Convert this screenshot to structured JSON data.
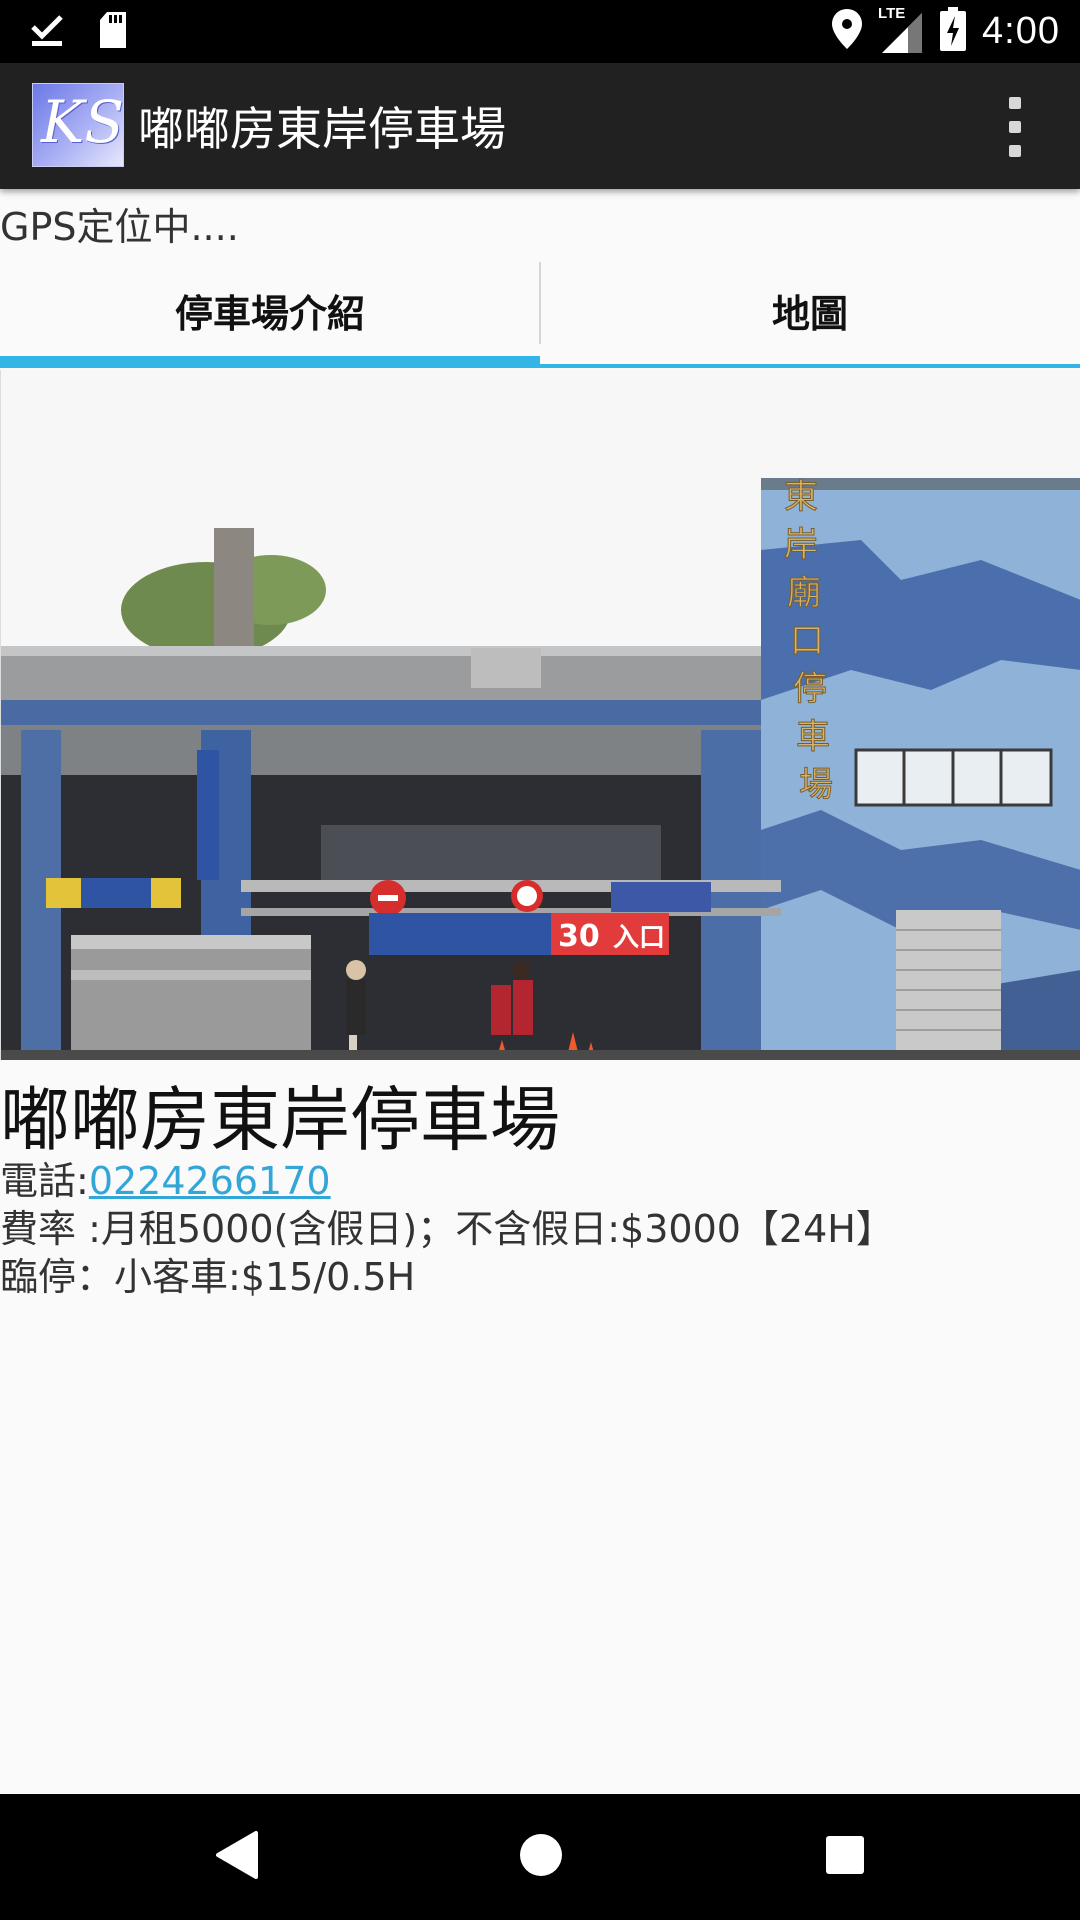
{
  "status_bar": {
    "time": "4:00",
    "left_icons": [
      "download-done-icon",
      "sd-card-icon"
    ],
    "right_icons": [
      "location-icon",
      "lte-signal-icon",
      "battery-charging-icon"
    ],
    "network_label": "LTE"
  },
  "app_bar": {
    "logo_text": "KS",
    "title": "嘟嘟房東岸停車場",
    "menu_icon": "overflow-menu-icon"
  },
  "gps_status": "GPS定位中....",
  "tabs": [
    {
      "label": "停車場介紹",
      "active": true
    },
    {
      "label": "地圖",
      "active": false
    }
  ],
  "photo": {
    "vertical_sign": [
      "東",
      "岸",
      "廟",
      "口",
      "停",
      "車",
      "場"
    ],
    "banner_text_1": "30",
    "banner_text_2": "入口"
  },
  "details": {
    "name": "嘟嘟房東岸停車場",
    "phone_label": "電話:",
    "phone_number": "0224266170",
    "rate_line": "費率 :月租5000(含假日)；不含假日:$3000【24H】",
    "temp_line": "臨停：小客車:$15/0.5H"
  },
  "nav_bar": {
    "buttons": [
      "back-icon",
      "home-icon",
      "recents-icon"
    ]
  },
  "colors": {
    "accent": "#33b5e5",
    "app_bar": "#212121",
    "status_bar": "#000000",
    "link": "#33a6d8"
  }
}
